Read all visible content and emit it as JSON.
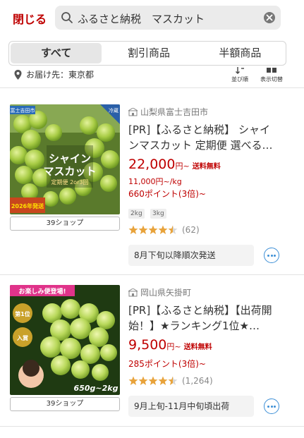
{
  "header": {
    "close_label": "閉じる",
    "search_value": "ふるさと納税　マスカット"
  },
  "tabs": [
    {
      "label": "すべて",
      "active": true
    },
    {
      "label": "割引商品",
      "active": false
    },
    {
      "label": "半額商品",
      "active": false
    }
  ],
  "location": {
    "label": "お届け先：東京都"
  },
  "tools": {
    "sort_label": "並び順",
    "view_label": "表示切替"
  },
  "colors": {
    "accent_red": "#bf0000",
    "star": "#e8a33b",
    "link_blue": "#3d8fd6"
  },
  "products": [
    {
      "region": "山梨県富士吉田市",
      "title": "[PR]【ふるさと納税】 シャインマスカット 定期便 選べる…",
      "price": "22,000",
      "price_unit": "円~",
      "shipping": "送料無料",
      "unit_price": "11,000円~/kg",
      "points": "660ポイント(3倍)~",
      "variants": [
        "2kg",
        "3kg"
      ],
      "rating": 4.5,
      "review_count": "(62)",
      "shop_label": "39ショップ",
      "ship_info": "8月下旬以降順次発送",
      "image": {
        "badge_top": "富士吉田市",
        "corner": "冷蔵",
        "line1": "シャイン",
        "line2": "マスカット",
        "sub": "定期便 2or3回",
        "year": "2026年発送"
      }
    },
    {
      "region": "岡山県矢掛町",
      "title": "[PR]【ふるさと納税】【出荷開始！】★ランキング1位★…",
      "price": "9,500",
      "price_unit": "円~",
      "shipping": "送料無料",
      "points": "285ポイント(3倍)~",
      "rating": 4.5,
      "review_count": "(1,264)",
      "shop_label": "39ショップ",
      "ship_info": "9月上旬-11月中旬頃出荷",
      "image": {
        "banner": "お楽しみ便登場!",
        "medal1": "第1位",
        "medal2": "入賞",
        "weight": "650g~2kg"
      }
    }
  ]
}
